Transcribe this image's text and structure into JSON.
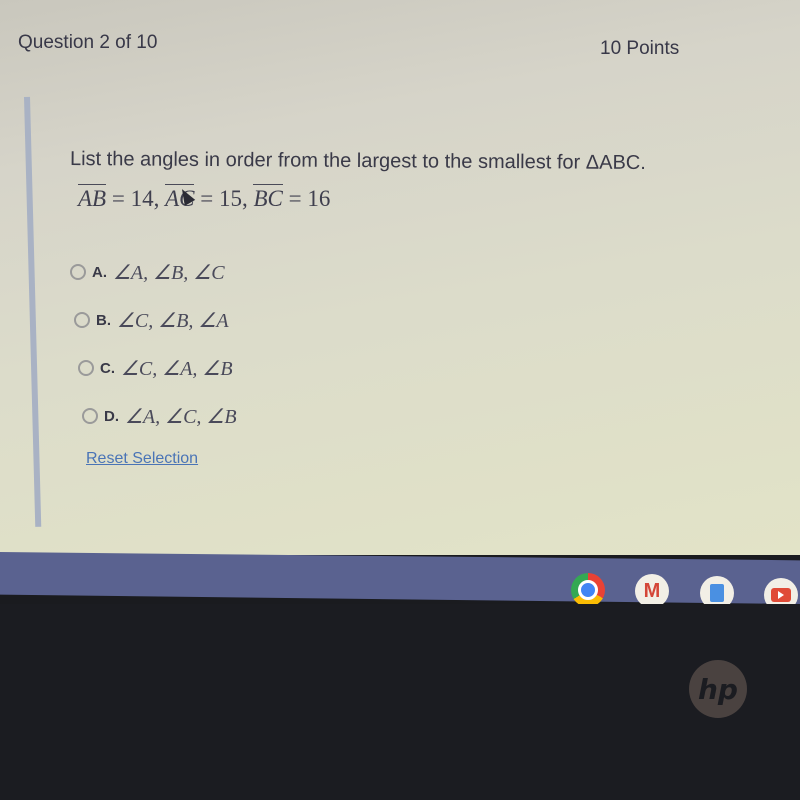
{
  "quiz": {
    "header": "Question 2 of 10",
    "points": "10 Points",
    "prompt": "List the angles in order from the largest to the smallest for ΔABC.",
    "equation": {
      "seg1": "AB",
      "val1": " = 14, ",
      "seg2": "AC",
      "val2": " = 15, ",
      "seg3": "BC",
      "val3": " = 16"
    },
    "options": [
      {
        "letter": "A.",
        "text": "∠A, ∠B, ∠C",
        "selected": false
      },
      {
        "letter": "B.",
        "text": "∠C, ∠B, ∠A",
        "selected": false
      },
      {
        "letter": "C.",
        "text": "∠C, ∠A, ∠B",
        "selected": false
      },
      {
        "letter": "D.",
        "text": "∠A, ∠C, ∠B",
        "selected": false
      }
    ],
    "reset_label": "Reset Selection"
  },
  "shelf": {
    "apps": [
      {
        "name": "chrome-icon",
        "label": "Chrome",
        "active": true
      },
      {
        "name": "gmail-icon",
        "label": "M"
      },
      {
        "name": "docs-icon",
        "label": "Docs"
      },
      {
        "name": "youtube-icon",
        "label": "YouTube"
      }
    ]
  },
  "device": {
    "logo": "hp"
  },
  "colors": {
    "link": "#4a74b6",
    "shelf": "#5a6290",
    "accent_bar": "#a9b2c4"
  }
}
